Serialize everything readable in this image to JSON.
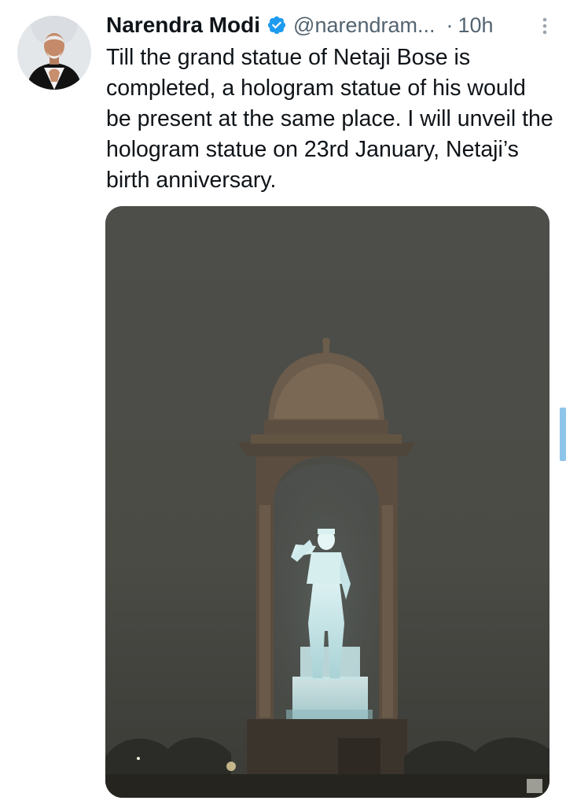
{
  "tweet": {
    "author": {
      "display_name": "Narendra Modi",
      "handle": "@narendram...",
      "verified": true,
      "avatar_icon": "profile-photo-icon"
    },
    "separator": "·",
    "timestamp": "10h",
    "text": "Till the grand statue of Netaji Bose is completed, a hologram statue of his would be present at the same place. I will unveil the hologram statue on 23rd January, Netaji’s birth anniversary.",
    "media": {
      "type": "photo",
      "icon": "hologram-statue-photo"
    },
    "more_icon": "more-vertical-icon"
  },
  "colors": {
    "text_primary": "#0f1419",
    "text_secondary": "#536471",
    "verified_blue": "#1d9bf0",
    "scroll_indicator": "#8ec5ea"
  }
}
